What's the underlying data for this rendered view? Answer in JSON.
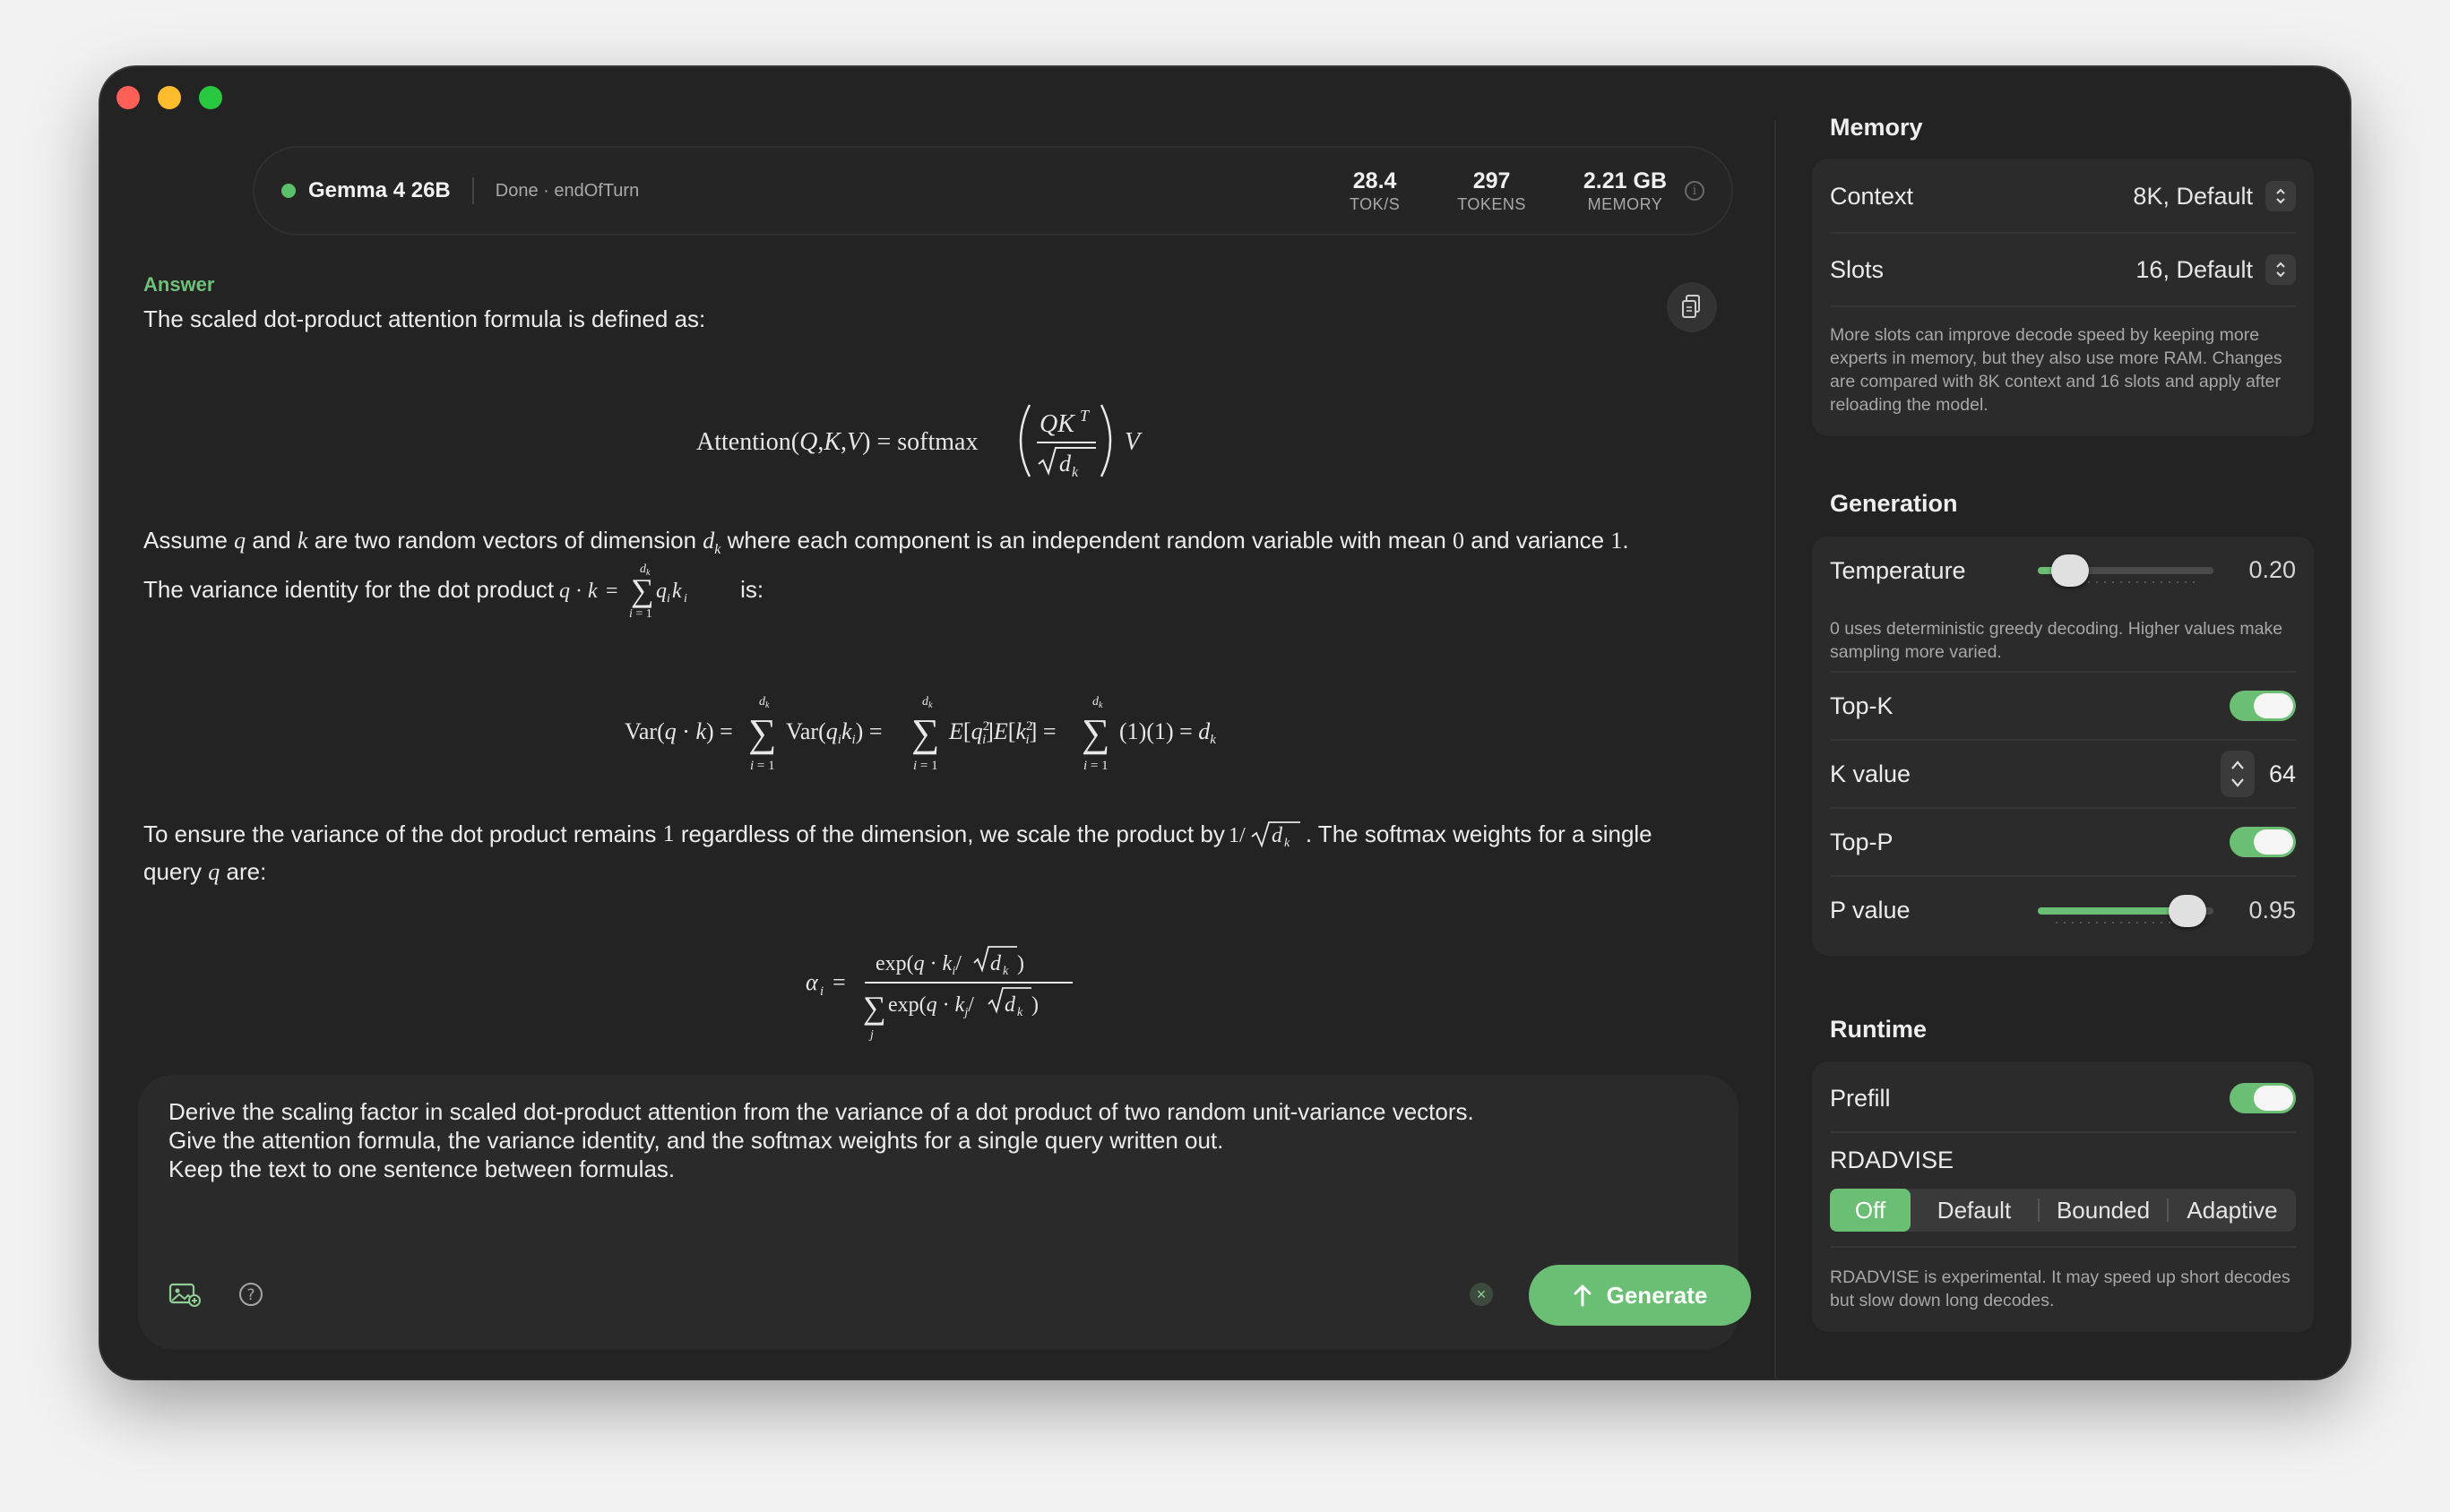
{
  "header": {
    "model_name": "Gemma 4 26B",
    "status": "Done · endOfTurn",
    "stats": [
      {
        "value": "28.4",
        "label": "TOK/S"
      },
      {
        "value": "297",
        "label": "TOKENS"
      },
      {
        "value": "2.21 GB",
        "label": "MEMORY"
      }
    ]
  },
  "answer": {
    "label": "Answer",
    "intro": "The scaled dot-product attention formula is defined as:",
    "p2_a": "Assume ",
    "p2_q": "q",
    "p2_b": " and ",
    "p2_k": "k",
    "p2_c": " are two random vectors of dimension ",
    "p2_d": " where each component is an independent random variable with mean ",
    "p2_zero": "0",
    "p2_e": " and variance ",
    "p2_one": "1",
    "p2_f": ".",
    "p3_a": "The variance identity for the dot product ",
    "p3_b": " is:",
    "p4_a": "To ensure the variance of the dot product remains ",
    "p4_one": "1",
    "p4_b": " regardless of the dimension, we scale the product by ",
    "p4_c": ". The softmax weights for a single",
    "p4_d": "query ",
    "p4_q": "q",
    "p4_e": " are:"
  },
  "prompt": {
    "text": "Derive the scaling factor in scaled dot-product attention from the variance of a dot product of two random unit-variance vectors.\nGive the attention formula, the variance identity, and the softmax weights for a single query written out.\nKeep the text to one sentence between formulas.",
    "generate_label": "Generate"
  },
  "panel": {
    "memory": {
      "title": "Memory",
      "context_label": "Context",
      "context_value": "8K, Default",
      "slots_label": "Slots",
      "slots_value": "16, Default",
      "note": "More slots can improve decode speed by keeping more experts in memory, but they also use more RAM. Changes are compared with 8K context and 16 slots and apply after reloading the model."
    },
    "generation": {
      "title": "Generation",
      "temperature_label": "Temperature",
      "temperature_value": "0.20",
      "temperature_fraction": 0.1,
      "temperature_note": "0 uses deterministic greedy decoding. Higher values make sampling more varied.",
      "topk_label": "Top-K",
      "topk_on": true,
      "kvalue_label": "K value",
      "kvalue": "64",
      "topp_label": "Top-P",
      "topp_on": true,
      "pvalue_label": "P value",
      "pvalue": "0.95",
      "pvalue_fraction": 0.95
    },
    "runtime": {
      "title": "Runtime",
      "prefill_label": "Prefill",
      "prefill_on": true,
      "rdadvise_label": "RDADVISE",
      "rdadvise_options": [
        "Off",
        "Default",
        "Bounded",
        "Adaptive"
      ],
      "rdadvise_selected": "Off",
      "note": "RDADVISE is experimental. It may speed up short decodes but slow down long decodes."
    }
  },
  "colors": {
    "accent": "#6abf75",
    "window_bg": "#232323",
    "card_bg": "#2b2b2b"
  }
}
